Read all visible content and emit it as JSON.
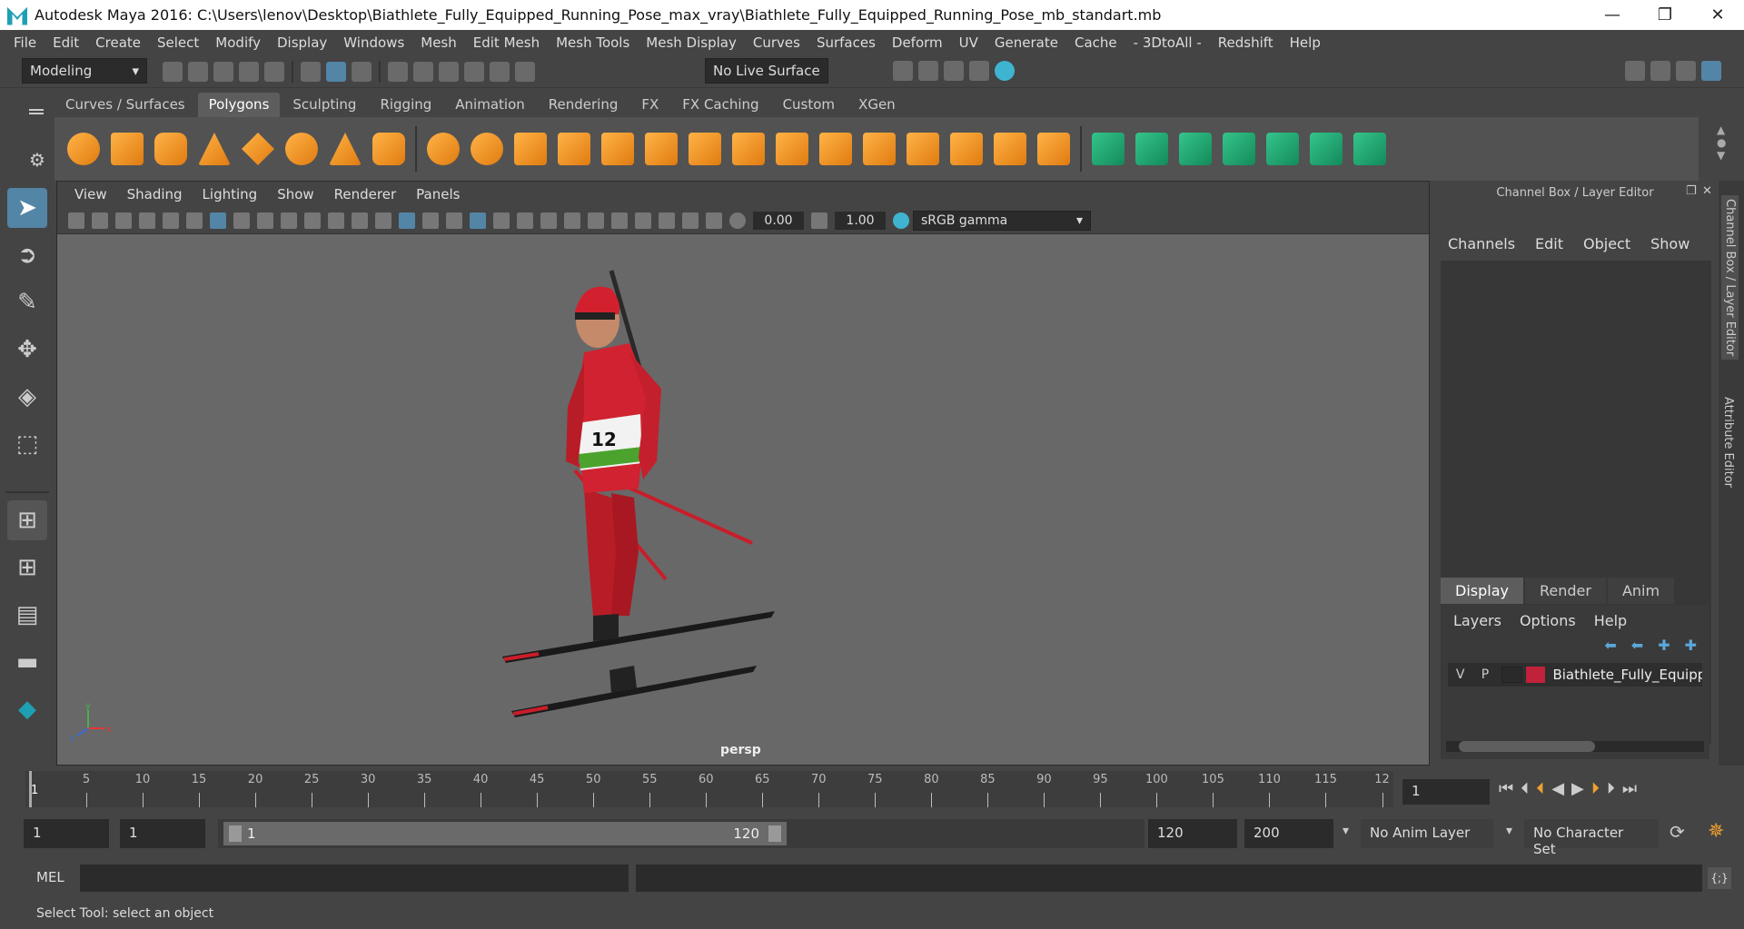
{
  "window": {
    "title": "Autodesk Maya 2016: C:\\Users\\lenov\\Desktop\\Biathlete_Fully_Equipped_Running_Pose_max_vray\\Biathlete_Fully_Equipped_Running_Pose_mb_standart.mb",
    "minimize": "—",
    "maximize": "❐",
    "close": "✕"
  },
  "menu": [
    "File",
    "Edit",
    "Create",
    "Select",
    "Modify",
    "Display",
    "Windows",
    "Mesh",
    "Edit Mesh",
    "Mesh Tools",
    "Mesh Display",
    "Curves",
    "Surfaces",
    "Deform",
    "UV",
    "Generate",
    "Cache",
    "- 3DtoAll -",
    "Redshift",
    "Help"
  ],
  "statusline": {
    "mode": "Modeling",
    "live_surface": "No Live Surface"
  },
  "shelf_tabs": [
    "Curves / Surfaces",
    "Polygons",
    "Sculpting",
    "Rigging",
    "Animation",
    "Rendering",
    "FX",
    "FX Caching",
    "Custom",
    "XGen"
  ],
  "shelf_active": "Polygons",
  "viewport": {
    "menu": [
      "View",
      "Shading",
      "Lighting",
      "Show",
      "Renderer",
      "Panels"
    ],
    "exposure": "0.00",
    "gamma": "1.00",
    "colorspace": "sRGB gamma",
    "camera": "persp",
    "axis_y": "y",
    "axis_x": "x",
    "axis_z": "z",
    "bib": "12"
  },
  "channel_box": {
    "title": "Channel Box / Layer Editor",
    "menu": [
      "Channels",
      "Edit",
      "Object",
      "Show"
    ]
  },
  "side_tabs": [
    "Channel Box / Layer Editor",
    "Attribute Editor"
  ],
  "layer_editor": {
    "tabs": [
      "Display",
      "Render",
      "Anim"
    ],
    "active": "Display",
    "menu": [
      "Layers",
      "Options",
      "Help"
    ],
    "layer": {
      "v": "V",
      "p": "P",
      "name": "Biathlete_Fully_Equipp",
      "color": "#c0213b"
    }
  },
  "timeline": {
    "ticks": [
      "5",
      "10",
      "15",
      "20",
      "25",
      "30",
      "35",
      "40",
      "45",
      "50",
      "55",
      "60",
      "65",
      "70",
      "75",
      "80",
      "85",
      "90",
      "95",
      "100",
      "105",
      "110",
      "115",
      "12"
    ],
    "current_frame_marker": "1",
    "current_frame": "1"
  },
  "range": {
    "start": "1",
    "playback_start": "1",
    "slider_start": "1",
    "slider_end": "120",
    "playback_end": "120",
    "end": "200",
    "anim_layer": "No Anim Layer",
    "char_set": "No Character Set"
  },
  "command": {
    "lang": "MEL"
  },
  "help_line": "Select Tool: select an object",
  "colors": {
    "accent": "#5285a6",
    "shelf_orange": "#f39a2b",
    "shelf_green": "#25b07a",
    "suit_red": "#c81e2a"
  }
}
